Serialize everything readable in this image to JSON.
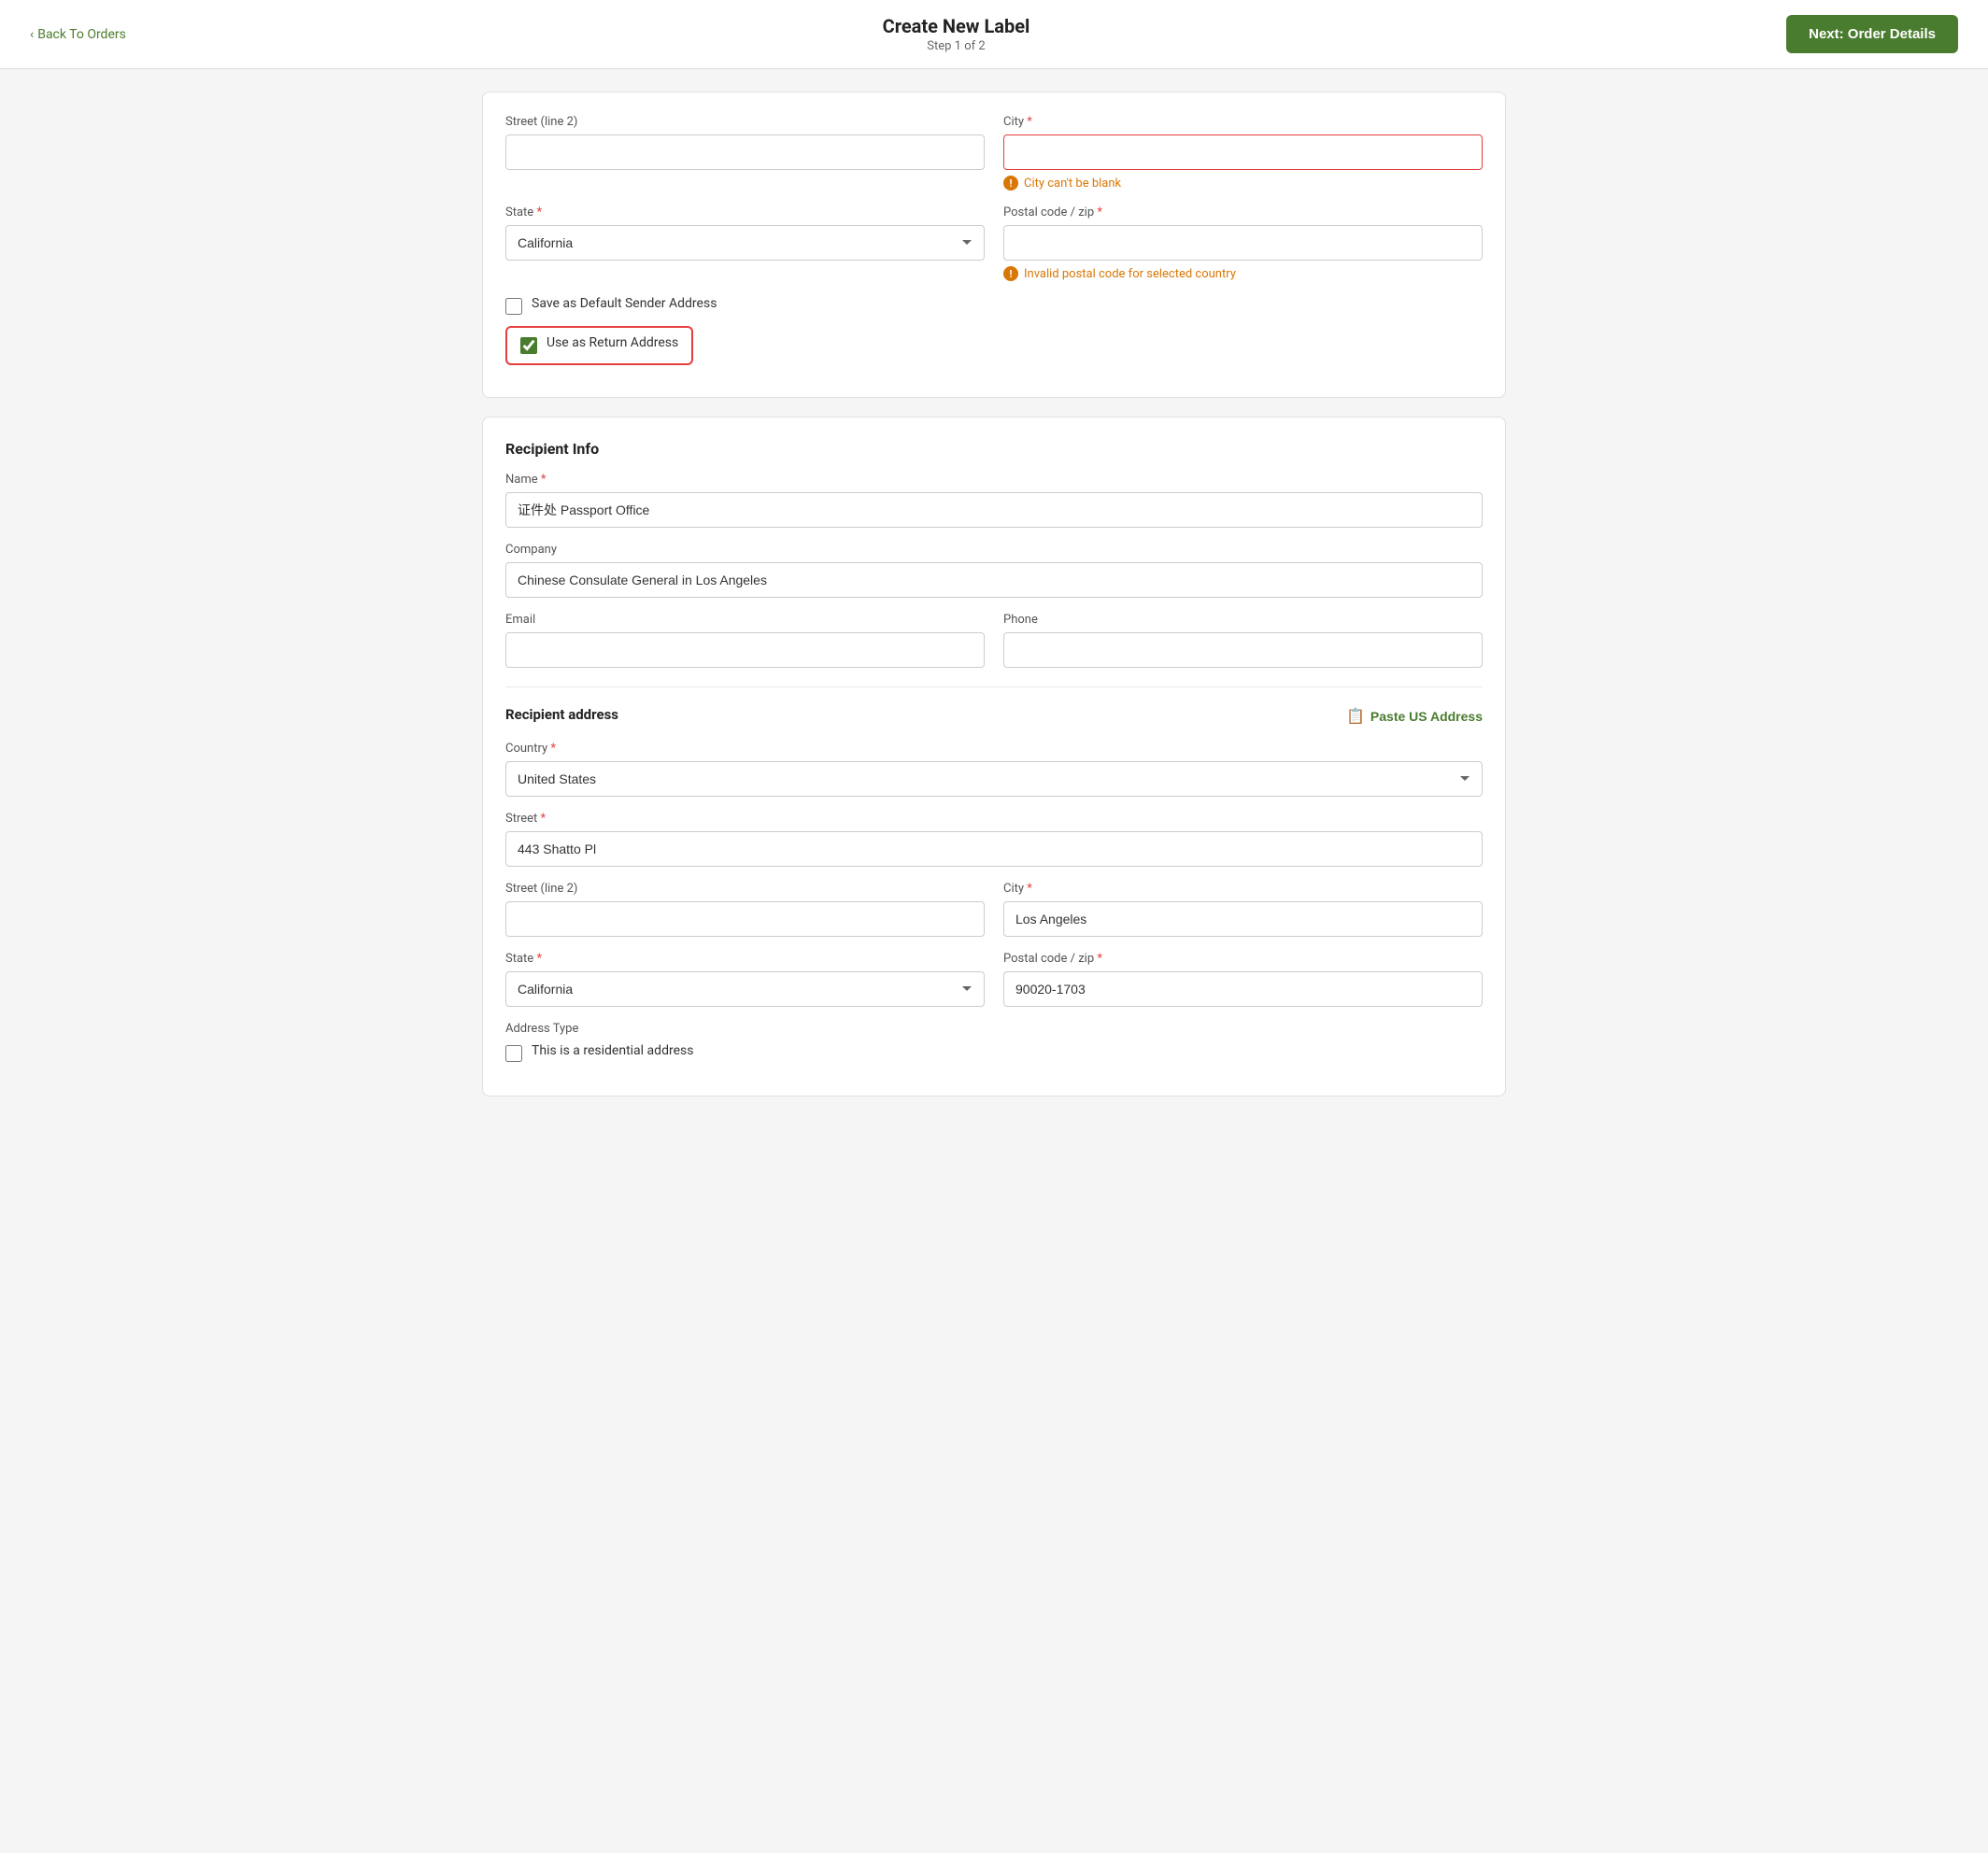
{
  "header": {
    "back_label": "Back To Orders",
    "title": "Create New Label",
    "step": "Step 1 of 2",
    "next_label": "Next: Order Details"
  },
  "sender_section": {
    "street2_label": "Street (line 2)",
    "street2_value": "",
    "city_label": "City",
    "city_required": "*",
    "city_value": "",
    "city_error": "City can't be blank",
    "state_label": "State",
    "state_required": "*",
    "state_value": "California",
    "postal_label": "Postal code / zip",
    "postal_required": "*",
    "postal_value": "",
    "postal_error": "Invalid postal code for selected country",
    "save_default_label": "Save as Default Sender Address",
    "use_return_label": "Use as Return Address"
  },
  "recipient_section": {
    "section_title": "Recipient Info",
    "name_label": "Name",
    "name_required": "*",
    "name_value": "证件处 Passport Office",
    "company_label": "Company",
    "company_value": "Chinese Consulate General in Los Angeles",
    "email_label": "Email",
    "email_value": "",
    "phone_label": "Phone",
    "phone_value": "",
    "address_title": "Recipient address",
    "paste_label": "Paste US Address",
    "country_label": "Country",
    "country_required": "*",
    "country_value": "United States",
    "street_label": "Street",
    "street_required": "*",
    "street_value": "443 Shatto Pl",
    "street2_label": "Street (line 2)",
    "street2_value": "",
    "city_label": "City",
    "city_required": "*",
    "city_value": "Los Angeles",
    "state_label": "State",
    "state_required": "*",
    "state_value": "California",
    "postal_label": "Postal code / zip",
    "postal_required": "*",
    "postal_value": "90020-1703",
    "address_type_label": "Address Type",
    "residential_label": "This is a residential address"
  }
}
